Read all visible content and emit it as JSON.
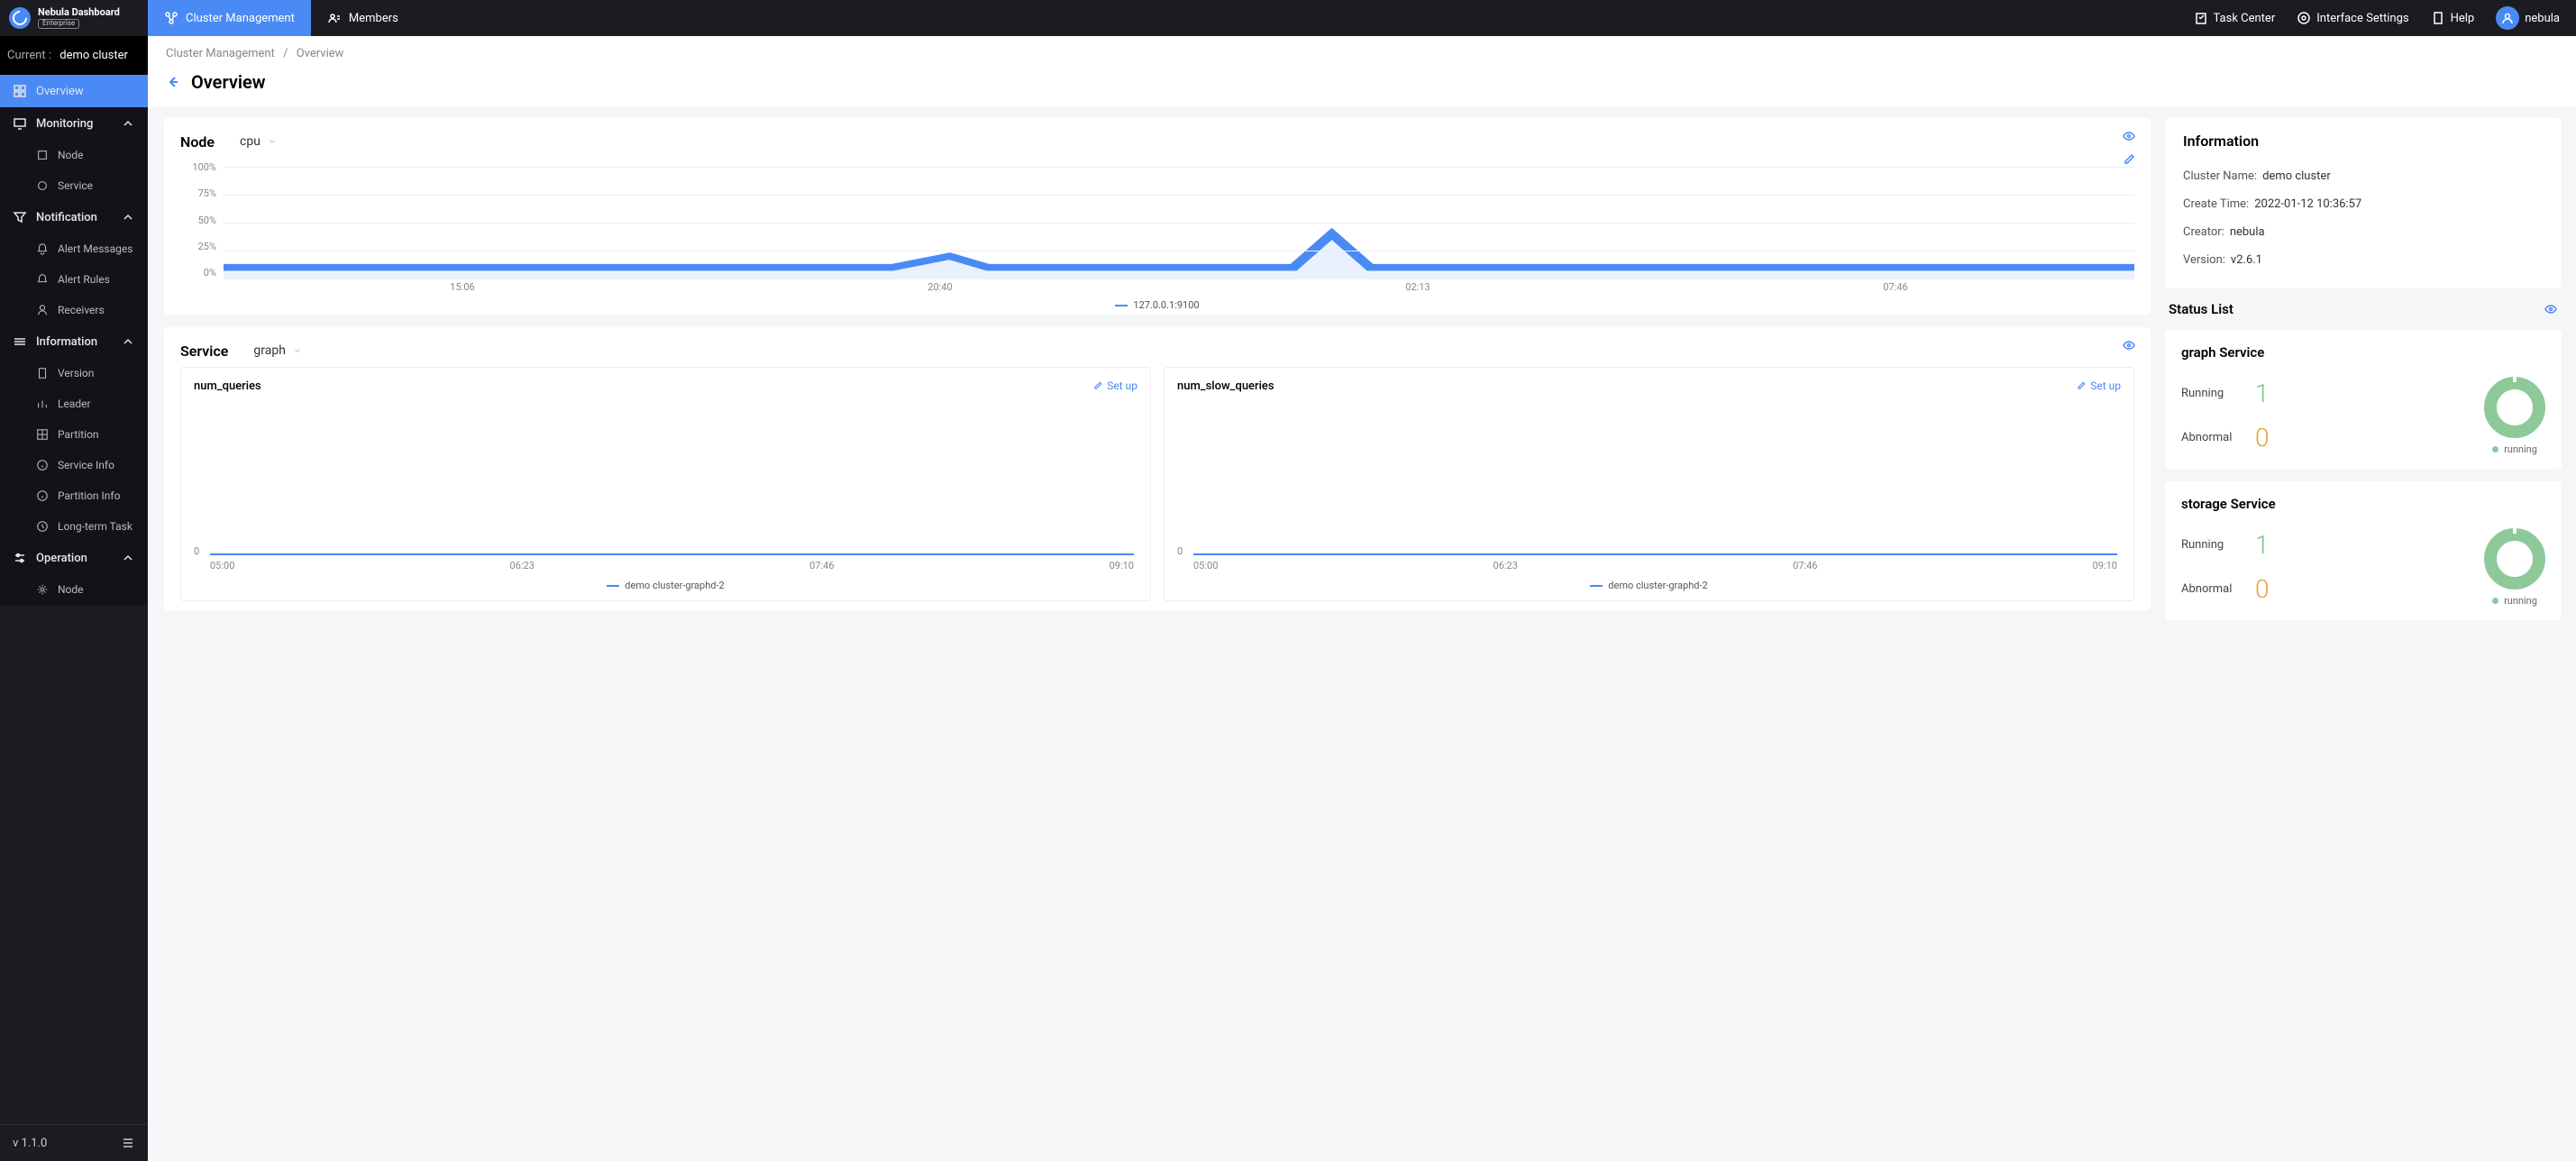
{
  "brand": {
    "title": "Nebula Dashboard",
    "badge": "Enterprise"
  },
  "current": {
    "label": "Current  :",
    "value": "demo cluster"
  },
  "nav": {
    "overview": "Overview",
    "monitoring": {
      "label": "Monitoring",
      "node": "Node",
      "service": "Service"
    },
    "notification": {
      "label": "Notification",
      "alert_messages": "Alert Messages",
      "alert_rules": "Alert Rules",
      "receivers": "Receivers"
    },
    "information": {
      "label": "Information",
      "version": "Version",
      "leader": "Leader",
      "partition": "Partition",
      "service_info": "Service Info",
      "partition_info": "Partition Info",
      "long_term_task": "Long-term Task"
    },
    "operation": {
      "label": "Operation",
      "node": "Node"
    }
  },
  "version": "v 1.1.0",
  "topbar": {
    "tabs": {
      "cluster": "Cluster Management",
      "members": "Members"
    },
    "right": {
      "task_center": "Task Center",
      "interface_settings": "Interface Settings",
      "help": "Help",
      "user": "nebula"
    }
  },
  "breadcrumb": {
    "root": "Cluster Management",
    "current": "Overview"
  },
  "page_title": "Overview",
  "node_panel": {
    "title": "Node",
    "metric": "cpu",
    "y_ticks": [
      "100%",
      "75%",
      "50%",
      "25%",
      "0%"
    ],
    "x_ticks": [
      "15:06",
      "20:40",
      "02:13",
      "07:46"
    ],
    "legend": "127.0.0.1:9100"
  },
  "service_panel": {
    "title": "Service",
    "metric": "graph",
    "charts": [
      {
        "title": "num_queries",
        "setup": "Set up",
        "zero": "0",
        "x_ticks": [
          "05:00",
          "06:23",
          "07:46",
          "09:10"
        ],
        "legend": "demo cluster-graphd-2"
      },
      {
        "title": "num_slow_queries",
        "setup": "Set up",
        "zero": "0",
        "x_ticks": [
          "05:00",
          "06:23",
          "07:46",
          "09:10"
        ],
        "legend": "demo cluster-graphd-2"
      }
    ]
  },
  "info_panel": {
    "title": "Information",
    "rows": {
      "cluster_name": {
        "label": "Cluster Name:",
        "value": "demo cluster"
      },
      "create_time": {
        "label": "Create Time:",
        "value": "2022-01-12 10:36:57"
      },
      "creator": {
        "label": "Creator:",
        "value": "nebula"
      },
      "version": {
        "label": "Version:",
        "value": "v2.6.1"
      }
    }
  },
  "status_list": {
    "title": "Status List",
    "services": [
      {
        "name": "graph Service",
        "running_label": "Running",
        "running": "1",
        "abnormal_label": "Abnormal",
        "abnormal": "0",
        "legend": "running"
      },
      {
        "name": "storage Service",
        "running_label": "Running",
        "running": "1",
        "abnormal_label": "Abnormal",
        "abnormal": "0",
        "legend": "running"
      }
    ]
  },
  "chart_data": [
    {
      "type": "line",
      "title": "Node cpu",
      "ylabel": "%",
      "ylim": [
        0,
        100
      ],
      "x": [
        "15:06",
        "20:40",
        "02:13",
        "07:46"
      ],
      "series": [
        {
          "name": "127.0.0.1:9100",
          "values": [
            3,
            3,
            5,
            3
          ]
        }
      ]
    },
    {
      "type": "line",
      "title": "num_queries",
      "ylim": [
        0,
        1
      ],
      "x": [
        "05:00",
        "06:23",
        "07:46",
        "09:10"
      ],
      "series": [
        {
          "name": "demo cluster-graphd-2",
          "values": [
            0,
            0,
            0,
            0
          ]
        }
      ]
    },
    {
      "type": "line",
      "title": "num_slow_queries",
      "ylim": [
        0,
        1
      ],
      "x": [
        "05:00",
        "06:23",
        "07:46",
        "09:10"
      ],
      "series": [
        {
          "name": "demo cluster-graphd-2",
          "values": [
            0,
            0,
            0,
            0
          ]
        }
      ]
    },
    {
      "type": "pie",
      "title": "graph Service status",
      "categories": [
        "running",
        "abnormal"
      ],
      "values": [
        1,
        0
      ]
    },
    {
      "type": "pie",
      "title": "storage Service status",
      "categories": [
        "running",
        "abnormal"
      ],
      "values": [
        1,
        0
      ]
    }
  ]
}
